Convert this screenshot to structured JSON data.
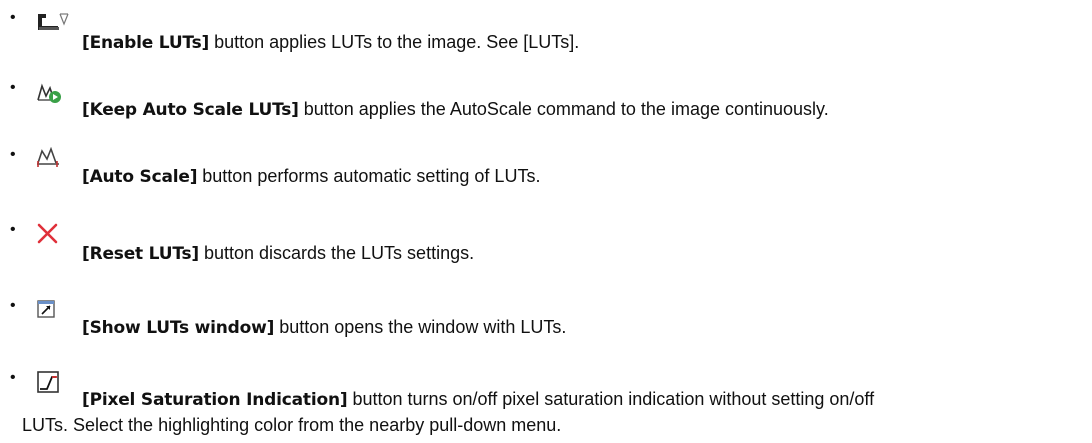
{
  "items": [
    {
      "label": "[Enable LUTs]",
      "text": " button applies LUTs to the image. See [LUTs].",
      "icon": "enable-luts-icon"
    },
    {
      "label": "[Keep Auto Scale LUTs]",
      "text": " button applies the AutoScale command to the image continuously.",
      "icon": "keep-auto-scale-icon"
    },
    {
      "label": "[Auto Scale]",
      "text": " button performs automatic setting of LUTs.",
      "icon": "auto-scale-icon"
    },
    {
      "label": "[Reset LUTs]",
      "text": " button discards the LUTs settings.",
      "icon": "reset-icon"
    },
    {
      "label": "[Show LUTs window]",
      "text": " button opens the window with LUTs.",
      "icon": "show-window-icon"
    },
    {
      "label": "[Pixel Saturation Indication]",
      "text": " button turns on/off pixel saturation indication without setting on/off",
      "text2": "LUTs. Select the highlighting color from the nearby pull-down menu.",
      "icon": "pixel-saturation-icon"
    }
  ],
  "bullet": "•"
}
